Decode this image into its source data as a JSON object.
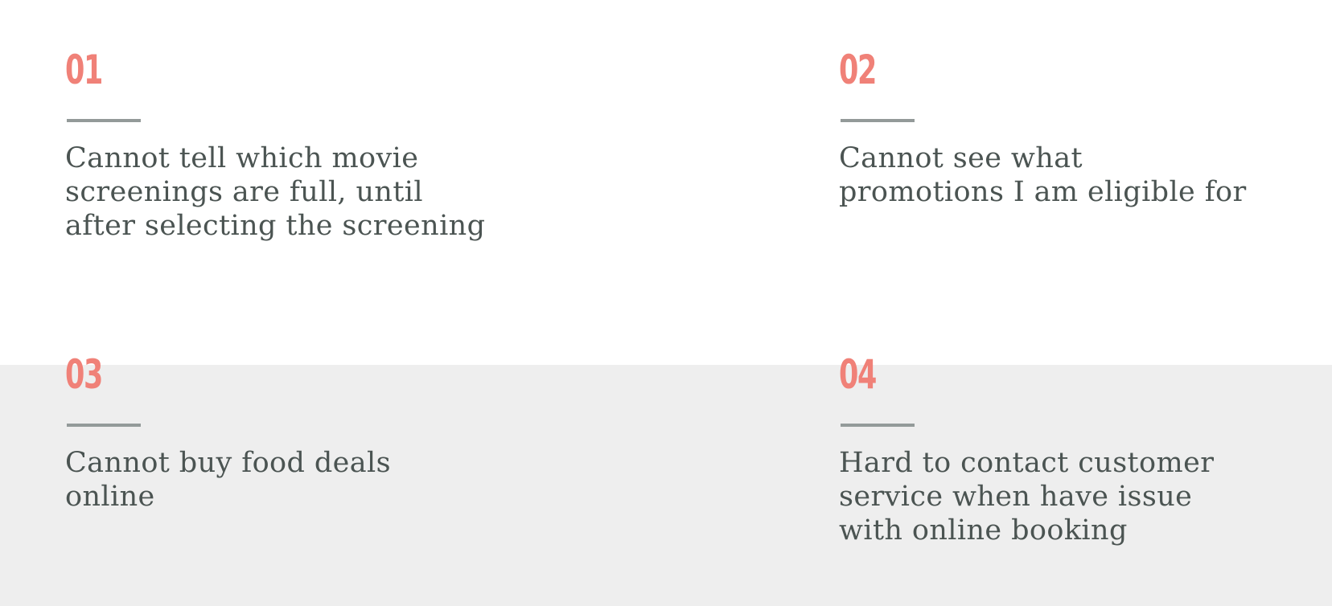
{
  "colors": {
    "accent": "#f08178",
    "rule": "#939a99",
    "text": "#4b5452",
    "background": "#ffffff",
    "band": "#eeeeee"
  },
  "cards": [
    {
      "number": "01",
      "lines": [
        "Cannot tell which movie",
        "screenings are full, until",
        "after selecting the screening"
      ]
    },
    {
      "number": "02",
      "lines": [
        "Cannot see what",
        "promotions I am eligible for"
      ]
    },
    {
      "number": "03",
      "lines": [
        "Cannot buy food deals",
        "online"
      ]
    },
    {
      "number": "04",
      "lines": [
        "Hard to contact customer",
        "service when have issue",
        "with online booking"
      ]
    }
  ]
}
